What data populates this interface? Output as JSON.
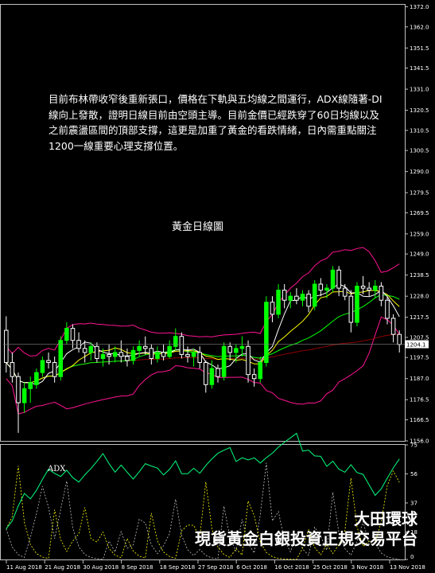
{
  "annotation": {
    "commentary": "目前布林帶收窄後重新張口，價格在下軌與五均線之間運行，ADX線隨著-DI線向上發散，證明日線目前由空頭主導。目前金價已經跌穿了60日均線以及之前震盪區間的頂部支撐，這更是加重了黃金的看跌情緒，日內需重點關注1200一線重要心理支撐位置。",
    "chart_title": "黃金日線圖",
    "adx_label": "ADX"
  },
  "watermark": {
    "line1": "大田環球",
    "line2": "現貨黃金白銀投資正規交易平台"
  },
  "colors": {
    "background": "#000000",
    "bull_candle": "#00ff00",
    "bear_candle": "#ffffff",
    "bollinger": "#ff1493",
    "ma5": "#ffffff",
    "ma10": "#ffff00",
    "ma20": "#00ff00",
    "ma60": "#8b0000",
    "ma120": "#0000cd",
    "price_label_bg": "#ffffff",
    "grid": "#555555"
  },
  "chart_data": [
    {
      "type": "candlestick",
      "symbol_price_label": "1204.1",
      "ylim": [
        1156.0,
        1373.0
      ],
      "y_ticks": [
        "1372.0",
        "1362.0",
        "1351.5",
        "1341.5",
        "1331.0",
        "1320.5",
        "1310.5",
        "1300.5",
        "1290.0",
        "1279.5",
        "1269.5",
        "1259.0",
        "1249.0",
        "1238.5",
        "1228.0",
        "1217.5",
        "1207.5",
        "1197.5",
        "1187.0",
        "1176.5",
        "1166.5",
        "1156.0"
      ],
      "x_ticks": [
        "11 Aug 2018",
        "21 Aug 2018",
        "30 Aug 2018",
        "8 Sep 2018",
        "18 Sep 2018",
        "27 Sep 2018",
        "6 Oct 2018",
        "16 Oct 2018",
        "25 Oct 2018",
        "3 Nov 2018",
        "13 Nov 2018"
      ],
      "candles": [
        {
          "date": "13 Aug 2018",
          "o": 1211,
          "h": 1218,
          "l": 1190,
          "c": 1195
        },
        {
          "date": "14 Aug 2018",
          "o": 1195,
          "h": 1200,
          "l": 1185,
          "c": 1188
        },
        {
          "date": "15 Aug 2018",
          "o": 1188,
          "h": 1190,
          "l": 1160,
          "c": 1175
        },
        {
          "date": "16 Aug 2018",
          "o": 1175,
          "h": 1185,
          "l": 1170,
          "c": 1182
        },
        {
          "date": "17 Aug 2018",
          "o": 1182,
          "h": 1188,
          "l": 1175,
          "c": 1185
        },
        {
          "date": "20 Aug 2018",
          "o": 1184,
          "h": 1192,
          "l": 1182,
          "c": 1190
        },
        {
          "date": "21 Aug 2018",
          "o": 1190,
          "h": 1198,
          "l": 1188,
          "c": 1196
        },
        {
          "date": "22 Aug 2018",
          "o": 1196,
          "h": 1200,
          "l": 1192,
          "c": 1195
        },
        {
          "date": "23 Aug 2018",
          "o": 1195,
          "h": 1198,
          "l": 1185,
          "c": 1188
        },
        {
          "date": "24 Aug 2018",
          "o": 1188,
          "h": 1208,
          "l": 1186,
          "c": 1206
        },
        {
          "date": "27 Aug 2018",
          "o": 1206,
          "h": 1215,
          "l": 1204,
          "c": 1212
        },
        {
          "date": "28 Aug 2018",
          "o": 1212,
          "h": 1214,
          "l": 1202,
          "c": 1206
        },
        {
          "date": "29 Aug 2018",
          "o": 1206,
          "h": 1210,
          "l": 1200,
          "c": 1202
        },
        {
          "date": "30 Aug 2018",
          "o": 1202,
          "h": 1206,
          "l": 1195,
          "c": 1200
        },
        {
          "date": "31 Aug 2018",
          "o": 1200,
          "h": 1205,
          "l": 1196,
          "c": 1203
        },
        {
          "date": "3 Sep 2018",
          "o": 1203,
          "h": 1205,
          "l": 1195,
          "c": 1197
        },
        {
          "date": "4 Sep 2018",
          "o": 1197,
          "h": 1202,
          "l": 1193,
          "c": 1199
        },
        {
          "date": "5 Sep 2018",
          "o": 1199,
          "h": 1204,
          "l": 1194,
          "c": 1198
        },
        {
          "date": "6 Sep 2018",
          "o": 1198,
          "h": 1203,
          "l": 1195,
          "c": 1200
        },
        {
          "date": "7 Sep 2018",
          "o": 1200,
          "h": 1206,
          "l": 1195,
          "c": 1198
        },
        {
          "date": "10 Sep 2018",
          "o": 1198,
          "h": 1202,
          "l": 1193,
          "c": 1196
        },
        {
          "date": "11 Sep 2018",
          "o": 1196,
          "h": 1203,
          "l": 1194,
          "c": 1201
        },
        {
          "date": "12 Sep 2018",
          "o": 1201,
          "h": 1206,
          "l": 1198,
          "c": 1203
        },
        {
          "date": "13 Sep 2018",
          "o": 1203,
          "h": 1208,
          "l": 1199,
          "c": 1202
        },
        {
          "date": "14 Sep 2018",
          "o": 1202,
          "h": 1204,
          "l": 1194,
          "c": 1197
        },
        {
          "date": "17 Sep 2018",
          "o": 1197,
          "h": 1203,
          "l": 1195,
          "c": 1200
        },
        {
          "date": "18 Sep 2018",
          "o": 1200,
          "h": 1204,
          "l": 1196,
          "c": 1198
        },
        {
          "date": "19 Sep 2018",
          "o": 1198,
          "h": 1206,
          "l": 1197,
          "c": 1203
        },
        {
          "date": "20 Sep 2018",
          "o": 1203,
          "h": 1212,
          "l": 1201,
          "c": 1208
        },
        {
          "date": "21 Sep 2018",
          "o": 1208,
          "h": 1210,
          "l": 1197,
          "c": 1199
        },
        {
          "date": "24 Sep 2018",
          "o": 1199,
          "h": 1203,
          "l": 1195,
          "c": 1198
        },
        {
          "date": "25 Sep 2018",
          "o": 1198,
          "h": 1202,
          "l": 1193,
          "c": 1200
        },
        {
          "date": "26 Sep 2018",
          "o": 1200,
          "h": 1203,
          "l": 1192,
          "c": 1195
        },
        {
          "date": "27 Sep 2018",
          "o": 1195,
          "h": 1196,
          "l": 1180,
          "c": 1184
        },
        {
          "date": "28 Sep 2018",
          "o": 1184,
          "h": 1196,
          "l": 1182,
          "c": 1192
        },
        {
          "date": "1 Oct 2018",
          "o": 1192,
          "h": 1194,
          "l": 1185,
          "c": 1188
        },
        {
          "date": "2 Oct 2018",
          "o": 1188,
          "h": 1205,
          "l": 1186,
          "c": 1203
        },
        {
          "date": "3 Oct 2018",
          "o": 1203,
          "h": 1205,
          "l": 1196,
          "c": 1200
        },
        {
          "date": "4 Oct 2018",
          "o": 1200,
          "h": 1204,
          "l": 1195,
          "c": 1202
        },
        {
          "date": "5 Oct 2018",
          "o": 1202,
          "h": 1208,
          "l": 1198,
          "c": 1203
        },
        {
          "date": "8 Oct 2018",
          "o": 1203,
          "h": 1206,
          "l": 1185,
          "c": 1189
        },
        {
          "date": "9 Oct 2018",
          "o": 1189,
          "h": 1192,
          "l": 1183,
          "c": 1187
        },
        {
          "date": "10 Oct 2018",
          "o": 1187,
          "h": 1198,
          "l": 1185,
          "c": 1195
        },
        {
          "date": "11 Oct 2018",
          "o": 1195,
          "h": 1228,
          "l": 1193,
          "c": 1225
        },
        {
          "date": "12 Oct 2018",
          "o": 1225,
          "h": 1228,
          "l": 1215,
          "c": 1219
        },
        {
          "date": "15 Oct 2018",
          "o": 1219,
          "h": 1234,
          "l": 1217,
          "c": 1231
        },
        {
          "date": "16 Oct 2018",
          "o": 1231,
          "h": 1234,
          "l": 1222,
          "c": 1226
        },
        {
          "date": "17 Oct 2018",
          "o": 1226,
          "h": 1230,
          "l": 1222,
          "c": 1228
        },
        {
          "date": "18 Oct 2018",
          "o": 1228,
          "h": 1232,
          "l": 1224,
          "c": 1226
        },
        {
          "date": "19 Oct 2018",
          "o": 1226,
          "h": 1231,
          "l": 1223,
          "c": 1229
        },
        {
          "date": "22 Oct 2018",
          "o": 1229,
          "h": 1231,
          "l": 1220,
          "c": 1223
        },
        {
          "date": "23 Oct 2018",
          "o": 1223,
          "h": 1236,
          "l": 1221,
          "c": 1234
        },
        {
          "date": "24 Oct 2018",
          "o": 1234,
          "h": 1237,
          "l": 1228,
          "c": 1231
        },
        {
          "date": "25 Oct 2018",
          "o": 1231,
          "h": 1234,
          "l": 1227,
          "c": 1232
        },
        {
          "date": "26 Oct 2018",
          "o": 1232,
          "h": 1243,
          "l": 1230,
          "c": 1241
        },
        {
          "date": "29 Oct 2018",
          "o": 1241,
          "h": 1243,
          "l": 1228,
          "c": 1232
        },
        {
          "date": "30 Oct 2018",
          "o": 1232,
          "h": 1234,
          "l": 1226,
          "c": 1228
        },
        {
          "date": "31 Oct 2018",
          "o": 1228,
          "h": 1231,
          "l": 1210,
          "c": 1215
        },
        {
          "date": "1 Nov 2018",
          "o": 1215,
          "h": 1235,
          "l": 1213,
          "c": 1233
        },
        {
          "date": "2 Nov 2018",
          "o": 1233,
          "h": 1238,
          "l": 1229,
          "c": 1232
        },
        {
          "date": "5 Nov 2018",
          "o": 1232,
          "h": 1235,
          "l": 1228,
          "c": 1231
        },
        {
          "date": "6 Nov 2018",
          "o": 1231,
          "h": 1236,
          "l": 1227,
          "c": 1233
        },
        {
          "date": "7 Nov 2018",
          "o": 1233,
          "h": 1235,
          "l": 1223,
          "c": 1226
        },
        {
          "date": "8 Nov 2018",
          "o": 1226,
          "h": 1228,
          "l": 1214,
          "c": 1217
        },
        {
          "date": "9 Nov 2018",
          "o": 1217,
          "h": 1219,
          "l": 1205,
          "c": 1209
        },
        {
          "date": "12 Nov 2018",
          "o": 1209,
          "h": 1211,
          "l": 1200,
          "c": 1204
        }
      ]
    },
    {
      "type": "line",
      "indicator": "ADX",
      "ylim": [
        0,
        75
      ],
      "y_ticks": [
        "75",
        "56",
        "37",
        "18",
        "0"
      ]
    }
  ]
}
